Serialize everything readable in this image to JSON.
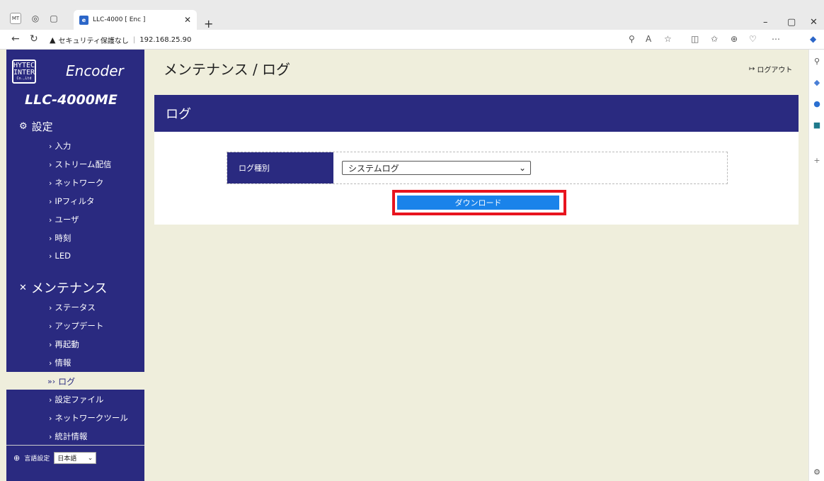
{
  "browser": {
    "profile_badge": "MT",
    "tab_title": "LLC-4000 [ Enc ]",
    "tab_favicon": "e",
    "security_label": "セキュリティ保護なし",
    "url": "192.168.25.90"
  },
  "sidebar": {
    "logo_lines": [
      "HYTEC",
      "INTER",
      "Co.,Ltd"
    ],
    "logo_text": "Encoder",
    "model": "LLC-4000ME",
    "settings_title": "設定",
    "settings_items": [
      "入力",
      "ストリーム配信",
      "ネットワーク",
      "IPフィルタ",
      "ユーザ",
      "時刻",
      "LED"
    ],
    "maintenance_title": "メンテナンス",
    "maintenance_items": [
      "ステータス",
      "アップデート",
      "再起動",
      "情報"
    ],
    "active_item": "ログ",
    "maintenance_items_after": [
      "設定ファイル",
      "ネットワークツール",
      "統計情報"
    ],
    "language_label": "言語設定",
    "language_value": "日本語"
  },
  "header": {
    "title": "メンテナンス / ログ",
    "logout": "ログアウト"
  },
  "panel": {
    "title": "ログ",
    "log_type_label": "ログ種別",
    "log_type_value": "システムログ",
    "download_label": "ダウンロード"
  },
  "colors": {
    "navy": "#2a2a80",
    "page_bg": "#efeedc",
    "button_blue": "#1a83ea",
    "highlight_red": "#e8141e"
  }
}
